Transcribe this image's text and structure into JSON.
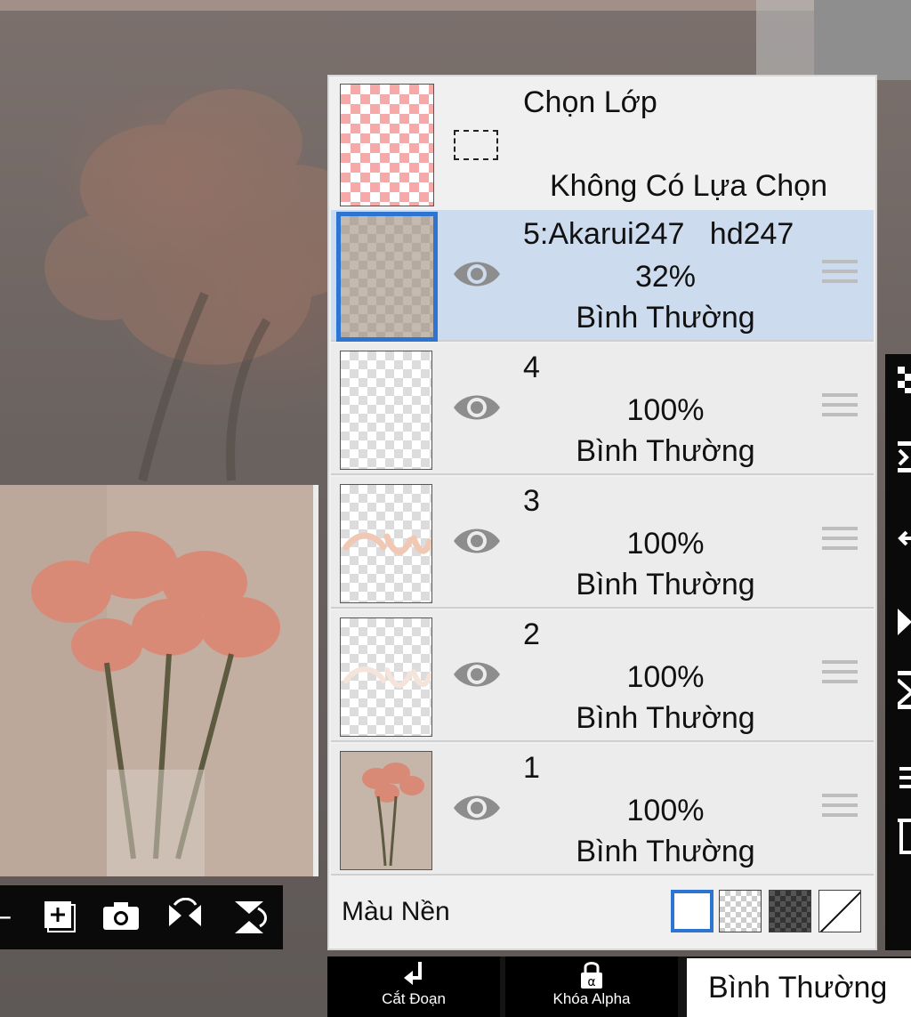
{
  "layers_panel": {
    "selection": {
      "title": "Chọn Lớp",
      "status": "Không Có Lựa Chọn"
    },
    "layers": [
      {
        "name": "5:Akarui247   hd247",
        "opacity": "32%",
        "blend": "Bình Thường",
        "active": true,
        "visible": true
      },
      {
        "name": "4",
        "opacity": "100%",
        "blend": "Bình Thường",
        "active": false,
        "visible": true
      },
      {
        "name": "3",
        "opacity": "100%",
        "blend": "Bình Thường",
        "active": false,
        "visible": true
      },
      {
        "name": "2",
        "opacity": "100%",
        "blend": "Bình Thường",
        "active": false,
        "visible": true
      },
      {
        "name": "1",
        "opacity": "100%",
        "blend": "Bình Thường",
        "active": false,
        "visible": true
      }
    ],
    "background": {
      "label": "Màu Nền",
      "options": [
        "white",
        "checker-light",
        "checker-dark",
        "none"
      ],
      "selected": "white"
    }
  },
  "bottom_toolbar": {
    "clip_label": "Cắt Đoạn",
    "alpha_lock_label": "Khóa Alpha",
    "blend_mode": "Bình Thường"
  },
  "mini_toolbar": {
    "icons": [
      "minus-icon",
      "add-layer-icon",
      "camera-icon",
      "flip-horizontal-icon",
      "flip-vertical-icon"
    ]
  },
  "colors": {
    "active_layer_bg": "#cddbee",
    "accent": "#2e74d1",
    "panel_bg": "#f0f0f0",
    "toolbar_bg": "#000000"
  }
}
